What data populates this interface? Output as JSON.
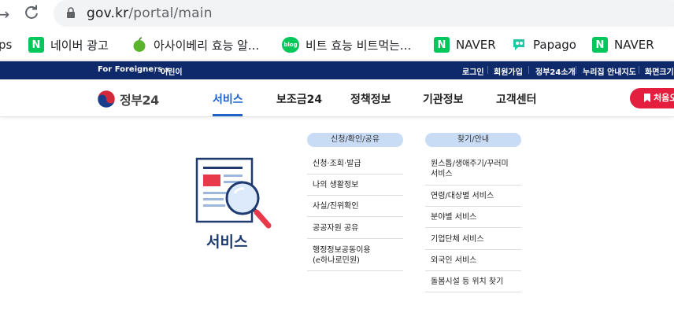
{
  "browser": {
    "url_host": "gov.kr",
    "url_path": "/portal/main",
    "bookmarks": [
      {
        "label": "ps",
        "icon": "apps-icon"
      },
      {
        "label": "네이버 광고",
        "icon": "naver-icon"
      },
      {
        "label": "아사이베리 효능 알...",
        "icon": "apple-icon"
      },
      {
        "label": "비트 효능 비트먹는...",
        "icon": "blog-icon"
      },
      {
        "label": "NAVER",
        "icon": "naver-icon"
      },
      {
        "label": "Papago",
        "icon": "papago-icon"
      },
      {
        "label": "NAVER",
        "icon": "naver-icon"
      }
    ]
  },
  "topbar": {
    "foreigners": "For Foreigners",
    "kids": "어린이",
    "login": "로그인",
    "join": "회원가입",
    "about": "정부24소개",
    "guide": "누리집 안내지도",
    "zoom": "화면크기"
  },
  "gnb": {
    "logo_text": "정부24",
    "menu": [
      "서비스",
      "보조금24",
      "정책정보",
      "기관정보",
      "고객센터"
    ],
    "cta": "처음오"
  },
  "dropdown": {
    "title": "서비스",
    "col1": {
      "head": "신청/확인/공유",
      "items": [
        "신청·조회·발급",
        "나의 생활정보",
        "사실/진위확인",
        "공공자원 공유"
      ],
      "last_line1": "행정정보공동이용",
      "last_line2": "(e하나로민원)"
    },
    "col2": {
      "head": "찾기/안내",
      "first_line1": "원스톱/생애주기/꾸러미",
      "first_line2": "서비스",
      "items": [
        "연령/대상별 서비스",
        "분야별 서비스",
        "기업단체 서비스",
        "외국인 서비스",
        "돌봄시설 등 위치 찾기"
      ]
    }
  },
  "colors": {
    "topbar_bg": "#0f2a6b",
    "accent_blue": "#1e62c8",
    "cta_red": "#e41e3f",
    "pill_bg": "#c9dcf5"
  }
}
